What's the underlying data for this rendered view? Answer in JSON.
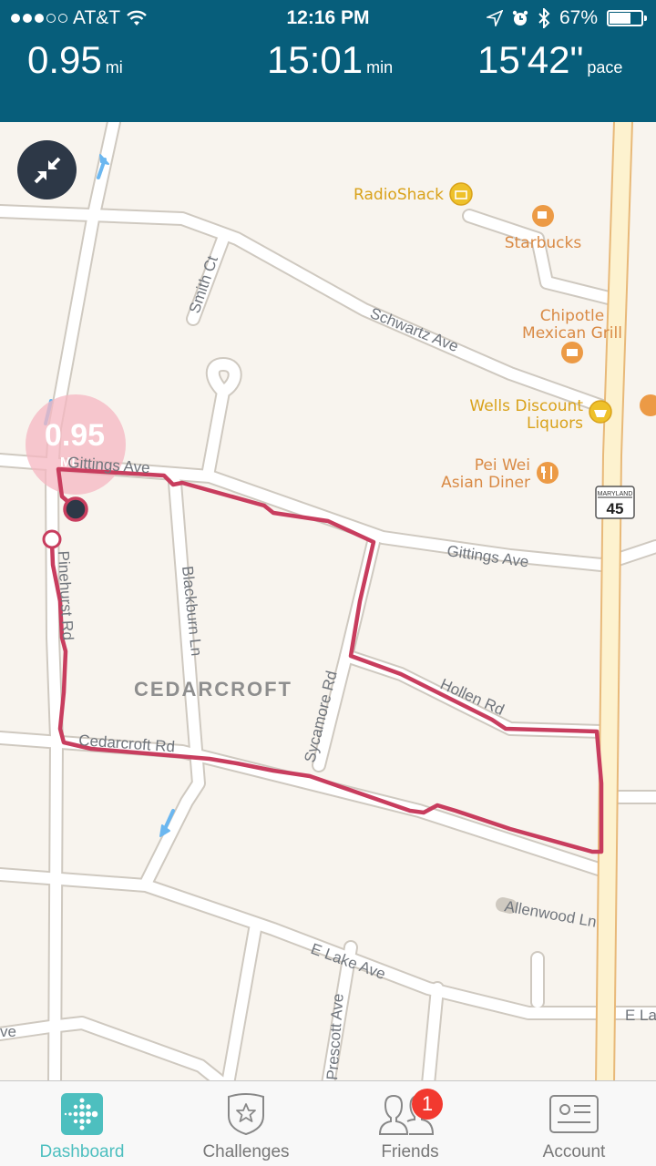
{
  "status_bar": {
    "carrier": "AT&T",
    "signal_bars": 3,
    "signal_max": 5,
    "time": "12:16 PM",
    "battery_percent_label": "67%",
    "battery_level": 0.67
  },
  "stats": {
    "distance": {
      "value": "0.95",
      "unit": "mi"
    },
    "duration": {
      "value": "15:01",
      "unit": "min"
    },
    "pace": {
      "value": "15'42\"",
      "unit": "pace"
    }
  },
  "map": {
    "collapse_button_icon": "collapse-arrows-icon",
    "distance_bubble": {
      "value": "0.95",
      "unit": "MI"
    },
    "neighborhood": "CEDARCROFT",
    "streets": [
      "Smith Ct",
      "Schwartz Ave",
      "Gittings Ave",
      "Gittings Ave",
      "Pinehurst Rd",
      "Blackburn Ln",
      "Sycamore Rd",
      "Hollen Rd",
      "Cedarcroft Rd",
      "Allenwood Ln",
      "E Lake Ave",
      "E La",
      "Prescott Ave",
      "ve"
    ],
    "pois": [
      {
        "name": "RadioShack",
        "icon": "shopping-bag-icon",
        "color": "#d9a21b"
      },
      {
        "name": "Starbucks",
        "icon": "coffee-cup-icon",
        "color": "#e38c3b"
      },
      {
        "name": "Chipotle Mexican Grill",
        "line1": "Chipotle",
        "line2": "Mexican Grill",
        "icon": "fast-food-icon",
        "color": "#e38c3b"
      },
      {
        "name": "Wells Discount Liquors",
        "line1": "Wells Discount",
        "line2": "Liquors",
        "icon": "shopping-basket-icon",
        "color": "#d9a21b"
      },
      {
        "name": "Pei Wei Asian Diner",
        "line1": "Pei Wei",
        "line2": "Asian Diner",
        "icon": "fork-knife-icon",
        "color": "#e38c3b"
      }
    ],
    "route_shield": {
      "state": "MARYLAND",
      "number": "45"
    },
    "route_color": "#c83d5e"
  },
  "tabbar": {
    "tabs": [
      {
        "label": "Dashboard",
        "icon": "fitbit-dots-icon",
        "active": true
      },
      {
        "label": "Challenges",
        "icon": "shield-star-icon",
        "active": false
      },
      {
        "label": "Friends",
        "icon": "friends-icon",
        "active": false,
        "badge": "1"
      },
      {
        "label": "Account",
        "icon": "id-card-icon",
        "active": false
      }
    ]
  },
  "colors": {
    "header": "#075e7b",
    "accent": "#4dbfbf",
    "badge": "#f2392f"
  }
}
